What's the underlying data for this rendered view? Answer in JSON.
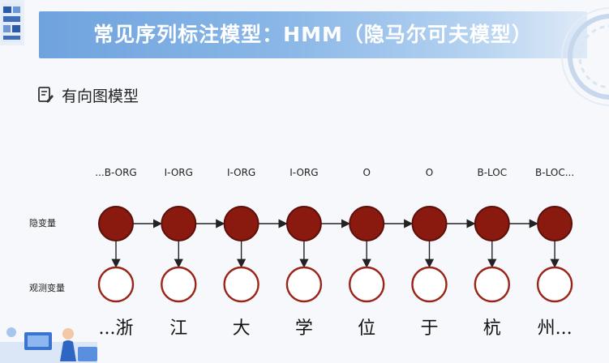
{
  "header": {
    "title": "常见序列标注模型：HMM（隐马尔可夫模型）"
  },
  "section": {
    "title": "有向图模型",
    "icon": "document-edit-icon"
  },
  "diagram": {
    "hidden_label": "隐变量",
    "observed_label": "观测变量",
    "tags": [
      "...B-ORG",
      "I-ORG",
      "I-ORG",
      "I-ORG",
      "O",
      "O",
      "B-LOC",
      "B-LOC..."
    ],
    "chars": [
      "...浙",
      "江",
      "大",
      "学",
      "位",
      "于",
      "杭",
      "州..."
    ],
    "colors": {
      "hidden_fill": "#8a1a10",
      "hidden_stroke": "#5c0f08",
      "observed_stroke": "#9b2419",
      "arrow": "#222222"
    }
  },
  "colors": {
    "banner_start": "#6fa3de",
    "banner_end": "#dfeaf7"
  }
}
